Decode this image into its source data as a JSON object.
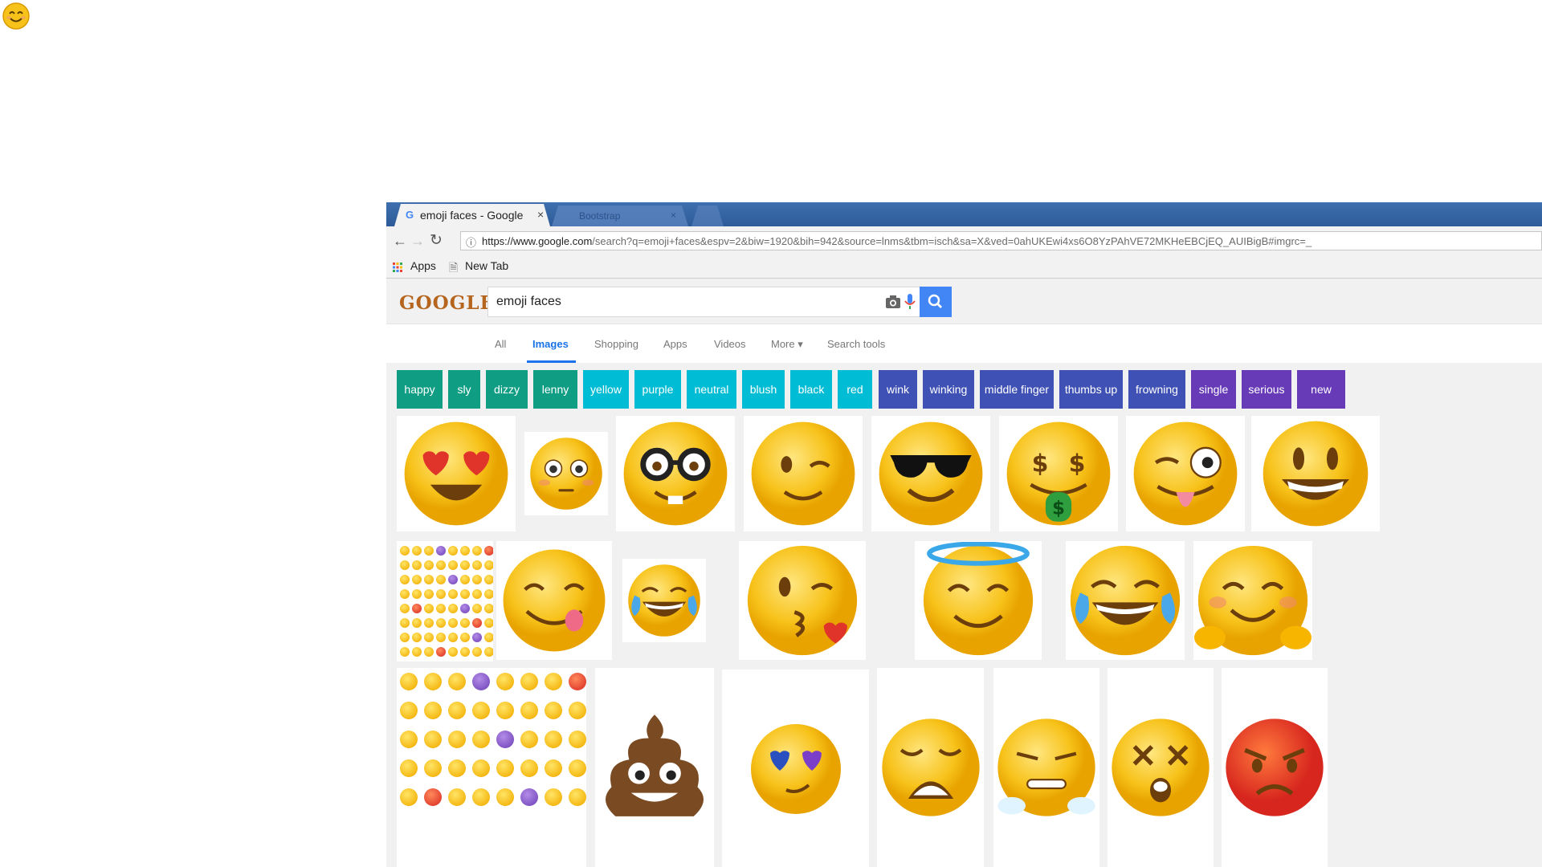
{
  "browser": {
    "active_tab": {
      "title": "emoji faces - Google",
      "favicon": "G",
      "close": "×"
    },
    "background_tab": {
      "title": "Bootstrap",
      "close": "×"
    },
    "url": "https://www.google.com/search?q=emoji+faces&espv=2&biw=1920&bih=942&source=lnms&tbm=isch&sa=X&ved=0ahUKEwi4xs6O8YzPAhVE72MKHeEBCjEQ_AUIBigB#imgrc=_",
    "url_host": "https://www.google.com",
    "url_path": "/search?q=emoji+faces&espv=2&biw=1920&bih=942&source=lnms&tbm=isch&sa=X&ved=0ahUKEwi4xs6O8YzPAhVE72MKHeEBCjEQ_AUIBigB#imgrc=_",
    "bookmarks": [
      "Apps",
      "New Tab"
    ]
  },
  "google": {
    "logo": "GOOGLE",
    "query": "emoji faces",
    "tabs": [
      "All",
      "Images",
      "Shopping",
      "Apps",
      "Videos",
      "More",
      "Search tools"
    ],
    "active_tab": "Images",
    "chips": [
      {
        "label": "happy",
        "color": "#0f9d84"
      },
      {
        "label": "sly",
        "color": "#0f9d84"
      },
      {
        "label": "dizzy",
        "color": "#0f9d84"
      },
      {
        "label": "lenny",
        "color": "#0f9d84"
      },
      {
        "label": "yellow",
        "color": "#00bcd4"
      },
      {
        "label": "purple",
        "color": "#00bcd4"
      },
      {
        "label": "neutral",
        "color": "#00bcd4"
      },
      {
        "label": "blush",
        "color": "#00bcd4"
      },
      {
        "label": "black",
        "color": "#00bcd4"
      },
      {
        "label": "red",
        "color": "#00bcd4"
      },
      {
        "label": "wink",
        "color": "#3f51b5"
      },
      {
        "label": "winking",
        "color": "#3f51b5"
      },
      {
        "label": "middle finger",
        "color": "#3f51b5"
      },
      {
        "label": "thumbs up",
        "color": "#3f51b5"
      },
      {
        "label": "frowning",
        "color": "#3f51b5"
      },
      {
        "label": "single",
        "color": "#673ab7"
      },
      {
        "label": "serious",
        "color": "#673ab7"
      },
      {
        "label": "new",
        "color": "#673ab7"
      }
    ],
    "image_results": [
      "heart-eyes-emoji",
      "flushed-emoji",
      "nerd-emoji",
      "wink-emoji",
      "sunglasses-emoji",
      "money-mouth-emoji",
      "crazy-face-emoji",
      "grinning-emoji",
      "emoji-grid-sheet",
      "yum-emoji",
      "tears-of-joy-emoji",
      "kissing-heart-emoji",
      "halo-emoji",
      "tears-of-joy-large-emoji",
      "hugging-emoji",
      "emoji-grid-sheet-2",
      "poop-emoji",
      "galaxy-eyes-emoji",
      "weary-emoji",
      "triumph-emoji",
      "dizzy-face-emoji",
      "angry-emoji"
    ]
  },
  "colors": {
    "emoji_yellow": "#f7c21a",
    "tab_bar": "#2d5b9a",
    "google_blue": "#4285f4"
  }
}
